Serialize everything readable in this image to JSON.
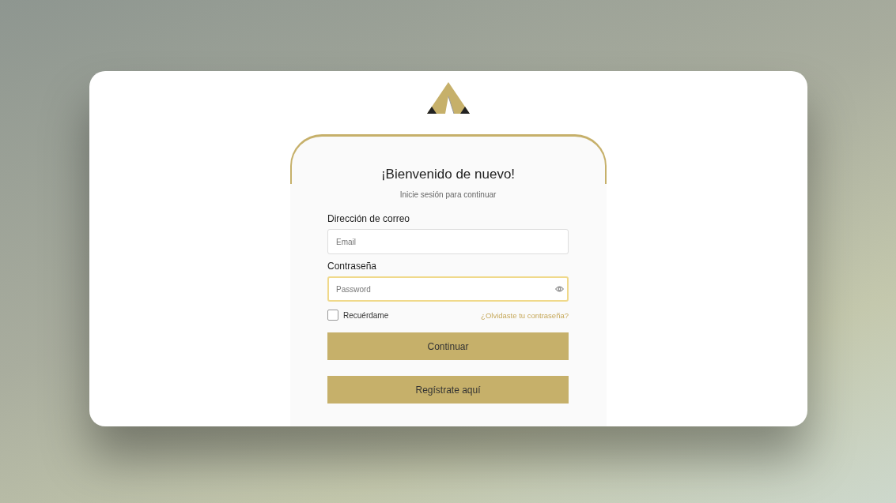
{
  "login": {
    "title": "¡Bienvenido de nuevo!",
    "subtitle": "Inicie sesión para continuar",
    "fields": [
      {
        "label": "Dirección de correo",
        "placeholder": "Email",
        "focused": false,
        "kind": "text"
      },
      {
        "label": "Contraseña",
        "placeholder": "Password",
        "focused": true,
        "kind": "password"
      }
    ],
    "remember": {
      "label": "Recuérdame",
      "checked": false
    },
    "forgot_link": "¿Olvidaste tu contraseña?",
    "buttons": [
      "Continuar",
      "Regístrate aquí"
    ]
  }
}
